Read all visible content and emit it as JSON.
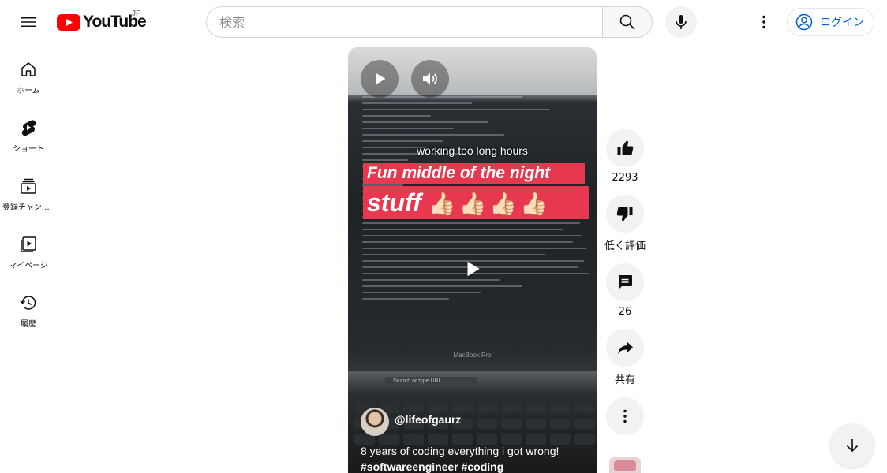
{
  "header": {
    "logo_text": "YouTube",
    "region": "JP",
    "search_placeholder": "検索",
    "login_label": "ログイン"
  },
  "sidebar": {
    "items": [
      {
        "label": "ホーム",
        "icon": "home-icon"
      },
      {
        "label": "ショート",
        "icon": "shorts-icon"
      },
      {
        "label": "登録チャンネル",
        "icon": "subscriptions-icon"
      },
      {
        "label": "マイページ",
        "icon": "library-icon"
      },
      {
        "label": "履歴",
        "icon": "history-icon"
      }
    ]
  },
  "video": {
    "caption_small": "working too long hours",
    "banner_line1": "Fun middle of the night",
    "banner_line2": "stuff",
    "banner_emoji": "👍🏻👍🏻👍🏻👍🏻",
    "screen_text_url": "Search or type URL",
    "screen_text_brand": "MacBook Pro",
    "channel_handle": "@lifeofgaurz",
    "title": "8 years of coding everything i got wrong!",
    "hashtags": "#softwareengineer #coding"
  },
  "actions": {
    "like_count": "2293",
    "dislike_label": "低く評価",
    "comment_count": "26",
    "share_label": "共有"
  },
  "colors": {
    "brand_red": "#ff0000",
    "banner_red": "#e8384f",
    "link_blue": "#065fd4"
  }
}
